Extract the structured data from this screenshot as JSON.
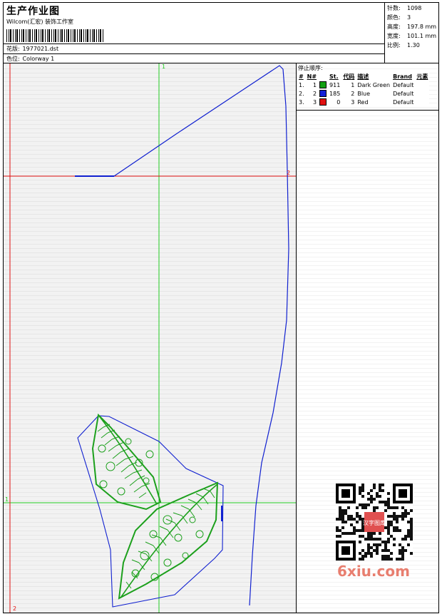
{
  "header": {
    "title": "生产作业图",
    "company": "Wilcom(汇宏) 装饰工作室",
    "design_key": "花版:",
    "design_value": "1977021.dst",
    "colorway_key": "色位:",
    "colorway_value": "Colorway 1"
  },
  "stats": [
    {
      "key": "针数:",
      "value": "1098"
    },
    {
      "key": "颜色:",
      "value": "3"
    },
    {
      "key": "高度:",
      "value": "197.8 mm"
    },
    {
      "key": "宽度:",
      "value": "101.1 mm"
    },
    {
      "key": "比例:",
      "value": "1.30"
    }
  ],
  "legend": {
    "heading": "停止顺序:",
    "columns": [
      "#",
      "N#",
      "St.",
      "代码",
      "描述",
      "Brand",
      "元素"
    ],
    "rows": [
      {
        "idx": "1.",
        "n": "1",
        "color": "#12a012",
        "st": "911",
        "code": "1",
        "desc": "Dark Green",
        "brand": "Default"
      },
      {
        "idx": "2.",
        "n": "2",
        "color": "#1220d8",
        "st": "185",
        "code": "2",
        "desc": "Blue",
        "brand": "Default"
      },
      {
        "idx": "3.",
        "n": "3",
        "color": "#e01010",
        "st": "0",
        "code": "3",
        "desc": "Red",
        "brand": "Default"
      }
    ]
  },
  "canvas": {
    "marker_top": "1",
    "marker_right": "2",
    "marker_left": "1",
    "marker_bottom": "2"
  },
  "watermark": "6xiu.com",
  "qr_badge": "汉字图库",
  "colors": {
    "green": "#1ca01c",
    "blue": "#1020d0",
    "red": "#e01010",
    "guide_green": "#22cc22"
  }
}
